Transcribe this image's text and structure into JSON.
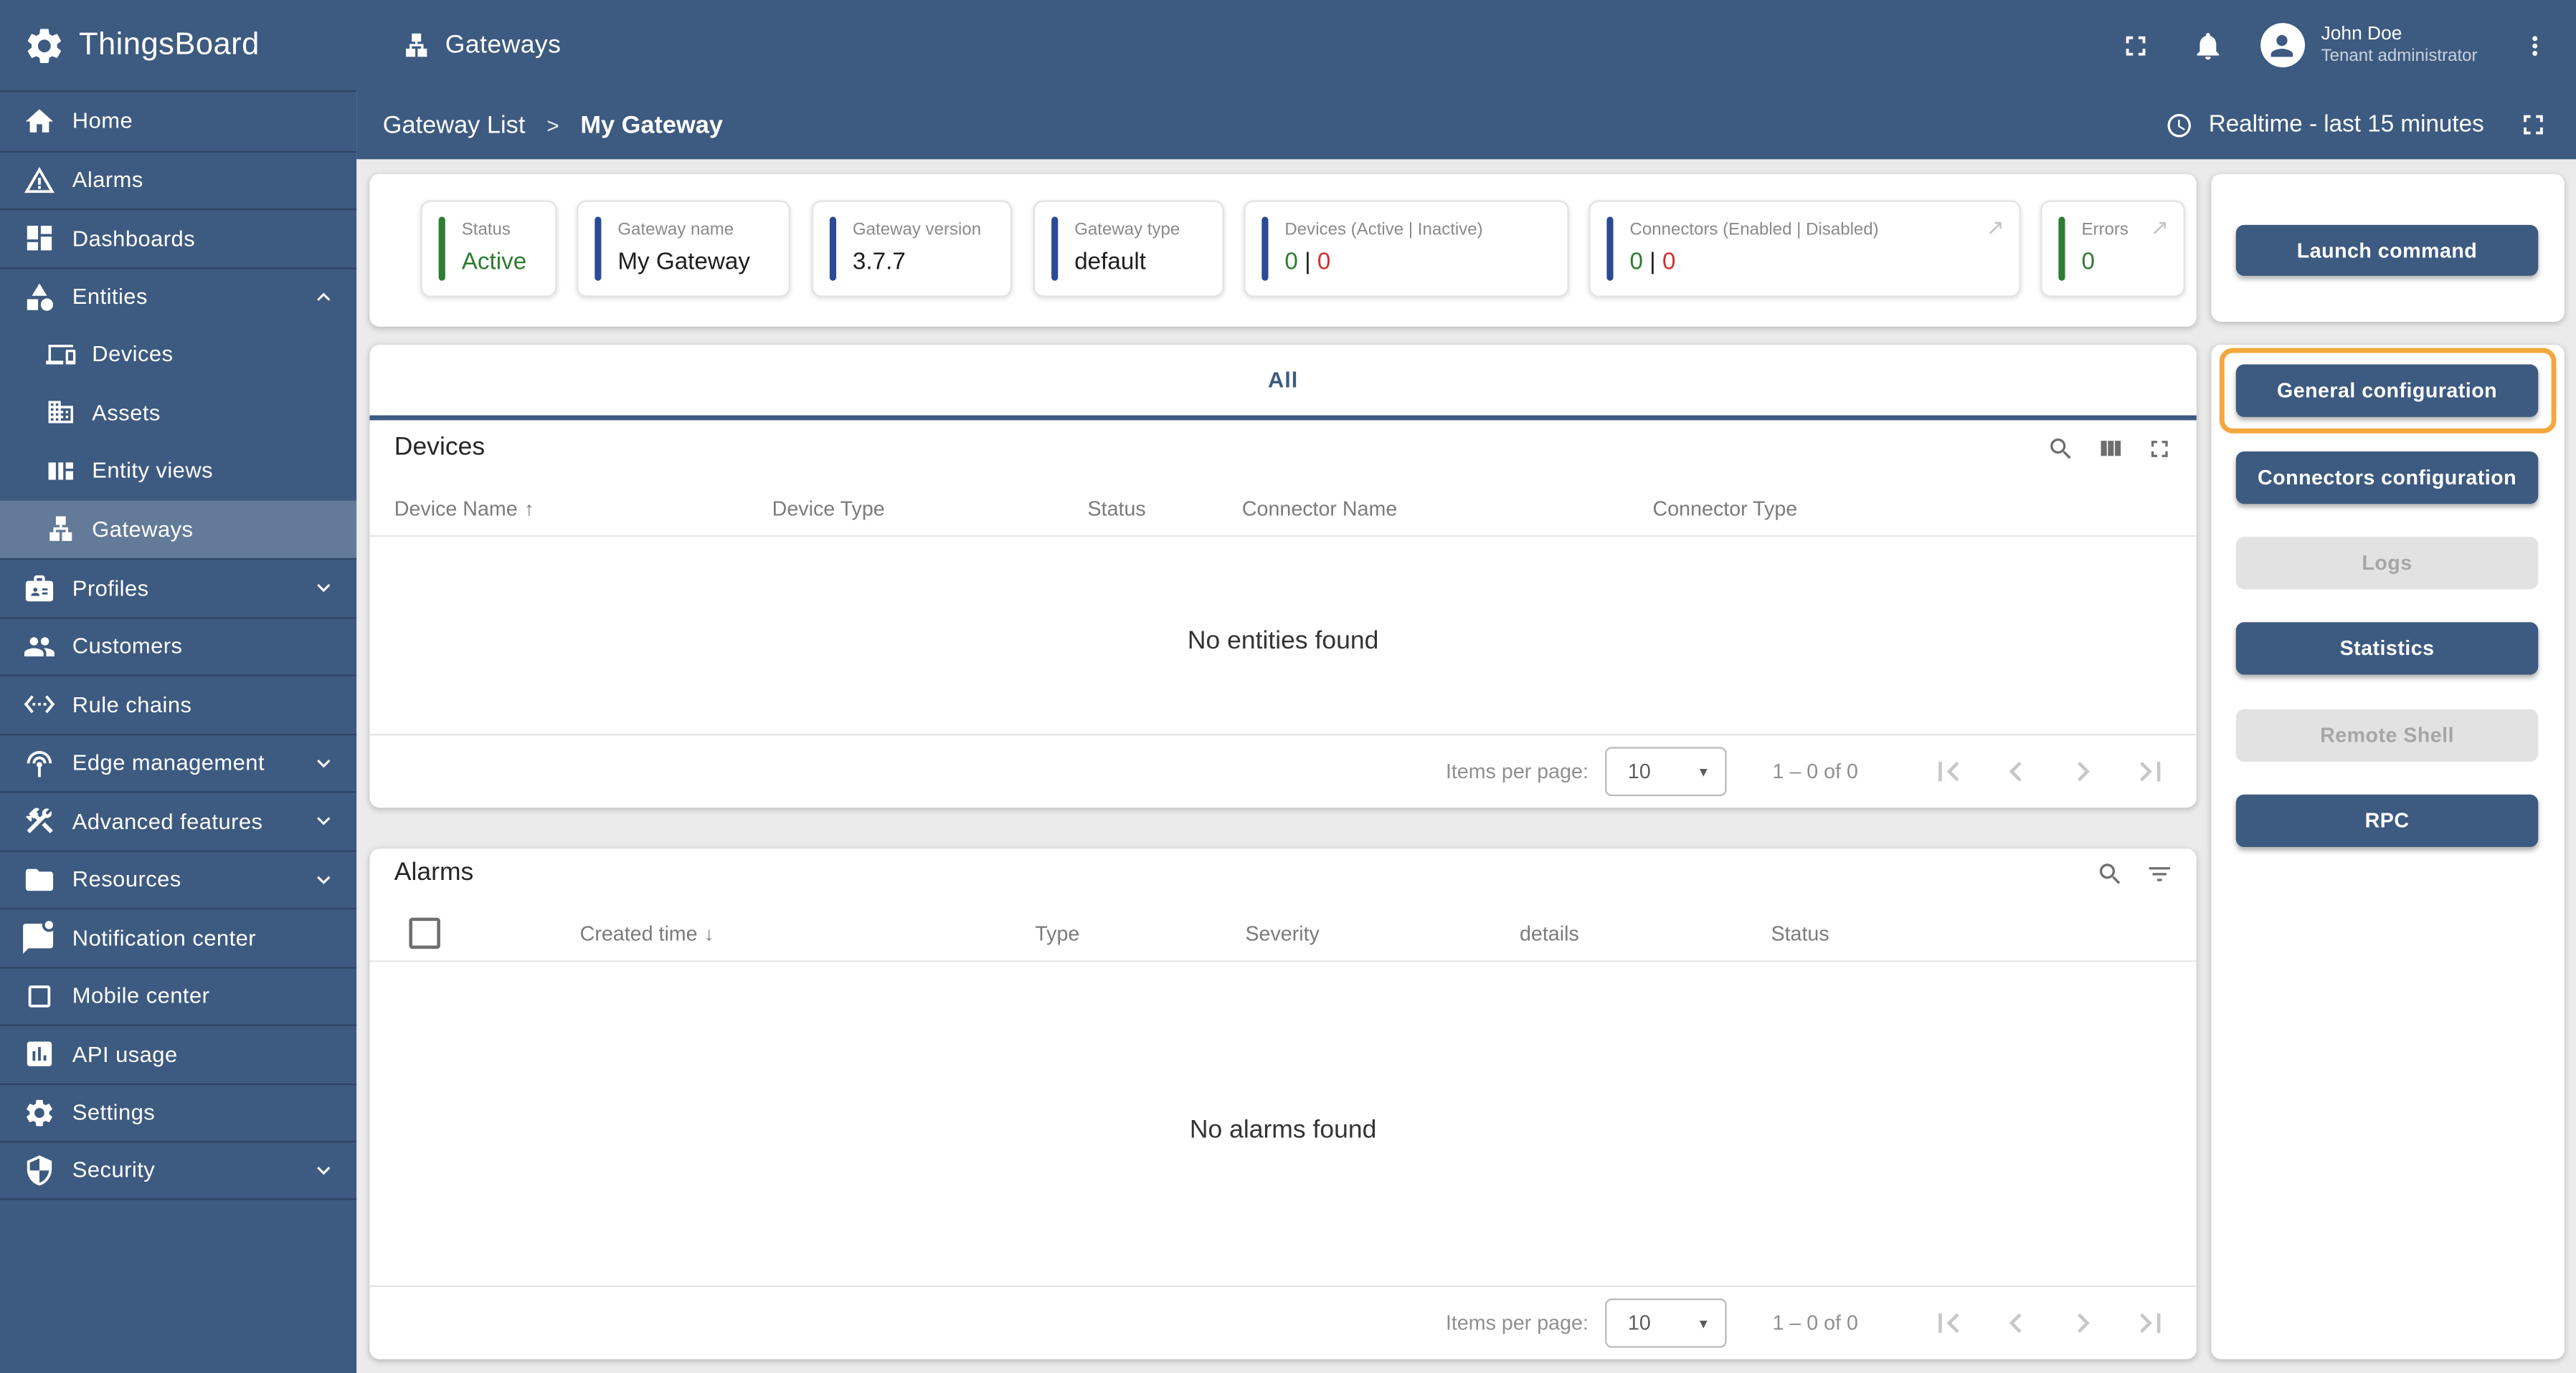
{
  "colors": {
    "header_bg": "#3d5a80",
    "accent_blue_bar": "#2a4a96",
    "accent_green": "#2e7d32",
    "value_red": "#d32f2f",
    "highlight_orange": "#f3a73c",
    "tab_blue": "#3d5a80"
  },
  "header": {
    "brand": "ThingsBoard",
    "page_title": "Gateways",
    "user": {
      "name": "John Doe",
      "role": "Tenant administrator"
    }
  },
  "breadcrumb": {
    "parent": "Gateway List",
    "separator": ">",
    "current": "My Gateway"
  },
  "timewindow": {
    "label": "Realtime - last 15 minutes"
  },
  "sidebar": {
    "items": [
      {
        "label": "Home"
      },
      {
        "label": "Alarms"
      },
      {
        "label": "Dashboards"
      },
      {
        "label": "Entities"
      },
      {
        "label": "Devices"
      },
      {
        "label": "Assets"
      },
      {
        "label": "Entity views"
      },
      {
        "label": "Gateways"
      },
      {
        "label": "Profiles"
      },
      {
        "label": "Customers"
      },
      {
        "label": "Rule chains"
      },
      {
        "label": "Edge management"
      },
      {
        "label": "Advanced features"
      },
      {
        "label": "Resources"
      },
      {
        "label": "Notification center"
      },
      {
        "label": "Mobile center"
      },
      {
        "label": "API usage"
      },
      {
        "label": "Settings"
      },
      {
        "label": "Security"
      }
    ]
  },
  "status_cards": [
    {
      "label": "Status",
      "value": "Active"
    },
    {
      "label": "Gateway name",
      "value": "My Gateway"
    },
    {
      "label": "Gateway version",
      "value": "3.7.7"
    },
    {
      "label": "Gateway type",
      "value": "default"
    },
    {
      "label": "Devices (Active | Inactive)",
      "value_green": "0",
      "value_sep": "|",
      "value_red": "0"
    },
    {
      "label": "Connectors (Enabled | Disabled)",
      "value_green": "0",
      "value_sep": "|",
      "value_red": "0",
      "link_arrow": "↗"
    },
    {
      "label": "Errors",
      "value": "0",
      "link_arrow": "↗"
    }
  ],
  "tabs": {
    "active": "All"
  },
  "devices_table": {
    "title": "Devices",
    "columns": [
      "Device Name",
      "Device Type",
      "Status",
      "Connector Name",
      "Connector Type"
    ],
    "sort_glyph": "↑",
    "empty_text": "No entities found",
    "pagination": {
      "items_per_page_label": "Items per page:",
      "page_size": "10",
      "caret": "▼",
      "range": "1 – 0 of 0"
    }
  },
  "alarms_table": {
    "title": "Alarms",
    "columns": [
      "Created time",
      "Type",
      "Severity",
      "details",
      "Status"
    ],
    "sort_glyph": "↓",
    "empty_text": "No alarms found",
    "pagination": {
      "items_per_page_label": "Items per page:",
      "page_size": "10",
      "caret": "▼",
      "range": "1 – 0 of 0"
    }
  },
  "actions": {
    "launch": "Launch command",
    "buttons": [
      {
        "label": "General configuration",
        "disabled": false,
        "highlighted": true
      },
      {
        "label": "Connectors configuration",
        "disabled": false
      },
      {
        "label": "Logs",
        "disabled": true
      },
      {
        "label": "Statistics",
        "disabled": false
      },
      {
        "label": "Remote Shell",
        "disabled": true
      },
      {
        "label": "RPC",
        "disabled": false
      }
    ]
  }
}
